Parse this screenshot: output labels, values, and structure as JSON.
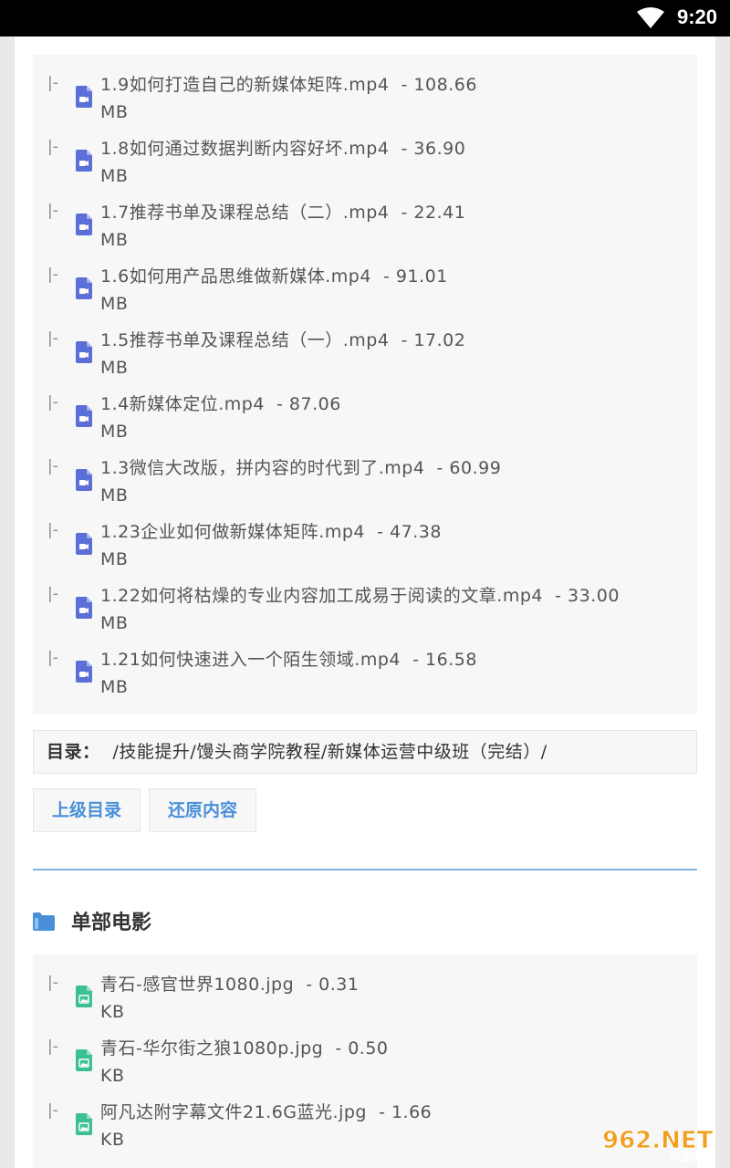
{
  "status_bar": {
    "time": "9:20"
  },
  "file_list": [
    {
      "name": "1.9如何打造自己的新媒体矩阵.mp4",
      "size": "108.66",
      "unit": "MB"
    },
    {
      "name": "1.8如何通过数据判断内容好坏.mp4",
      "size": "36.90",
      "unit": "MB"
    },
    {
      "name": "1.7推荐书单及课程总结（二）.mp4",
      "size": "22.41",
      "unit": "MB"
    },
    {
      "name": "1.6如何用产品思维做新媒体.mp4",
      "size": "91.01",
      "unit": "MB"
    },
    {
      "name": "1.5推荐书单及课程总结（一）.mp4",
      "size": "17.02",
      "unit": "MB"
    },
    {
      "name": "1.4新媒体定位.mp4",
      "size": "87.06",
      "unit": "MB"
    },
    {
      "name": "1.3微信大改版，拼内容的时代到了.mp4",
      "size": "60.99",
      "unit": "MB"
    },
    {
      "name": "1.23企业如何做新媒体矩阵.mp4",
      "size": "47.38",
      "unit": "MB"
    },
    {
      "name": "1.22如何将枯燥的专业内容加工成易于阅读的文章.mp4",
      "size": "33.00",
      "unit": "MB"
    },
    {
      "name": "1.21如何快速进入一个陌生领域.mp4",
      "size": "16.58",
      "unit": "MB"
    }
  ],
  "tree_prefix": "|-",
  "size_separator": "-",
  "path": {
    "label": "目录：",
    "value": "/技能提升/馒头商学院教程/新媒体运营中级班（完结）/"
  },
  "buttons": {
    "parent_dir": "上级目录",
    "restore": "还原内容"
  },
  "section": {
    "title": "单部电影"
  },
  "image_list": [
    {
      "name": "青石-感官世界1080.jpg",
      "size": "0.31",
      "unit": "KB"
    },
    {
      "name": "青石-华尔街之狼1080p.jpg",
      "size": "0.50",
      "unit": "KB"
    },
    {
      "name": "阿凡达附字幕文件21.6G蓝光.jpg",
      "size": "1.66",
      "unit": "KB"
    }
  ],
  "watermark": {
    "brand": "962.NET",
    "sub": "乐游网"
  },
  "colors": {
    "video_icon": "#5b6fd6",
    "image_icon": "#3dbf95",
    "link": "#4a90d9",
    "divider": "#7fb3e4"
  }
}
